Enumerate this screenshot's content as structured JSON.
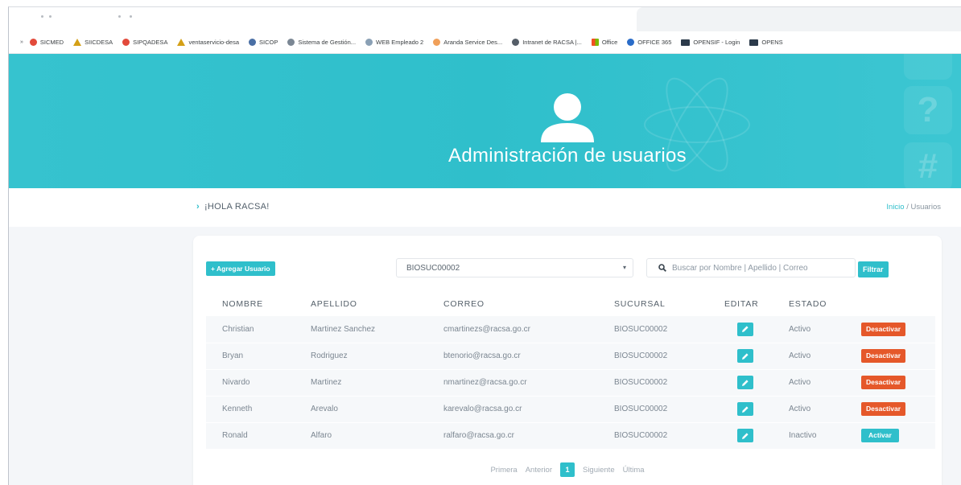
{
  "bookmarks": [
    "SICMED",
    "SIICDESA",
    "SIPQADESA",
    "ventaservicio-desa",
    "SICOP",
    "Sistema de Gestión...",
    "WEB Empleado 2",
    "Aranda Service Des...",
    "Intranet de RACSA |...",
    "Office",
    "OFFICE 365",
    "OPENSIF - Login",
    "OPENS"
  ],
  "hero": {
    "title": "Administración de usuarios",
    "side_icons": [
      "?",
      "#"
    ]
  },
  "greeting": "¡HOLA RACSA!",
  "breadcrumb": {
    "home": "Inicio",
    "separator": " / ",
    "current": "Usuarios"
  },
  "toolbar": {
    "add_label": "+ Agregar Usuario",
    "branch_value": "BIOSUC00002",
    "search_placeholder": "Buscar por Nombre | Apellido | Correo",
    "filter_label": "Filtrar"
  },
  "table": {
    "headers": {
      "name": "NOMBRE",
      "surname": "APELLIDO",
      "email": "CORREO",
      "branch": "SUCURSAL",
      "edit": "EDITAR",
      "status": "ESTADO"
    },
    "rows": [
      {
        "name": "Christian",
        "surname": "Martinez Sanchez",
        "email": "cmartinezs@racsa.go.cr",
        "branch": "BIOSUC00002",
        "status": "Activo",
        "action": "Desactivar"
      },
      {
        "name": "Bryan",
        "surname": "Rodriguez",
        "email": "btenorio@racsa.go.cr",
        "branch": "BIOSUC00002",
        "status": "Activo",
        "action": "Desactivar"
      },
      {
        "name": "Nivardo",
        "surname": "Martinez",
        "email": "nmartinez@racsa.go.cr",
        "branch": "BIOSUC00002",
        "status": "Activo",
        "action": "Desactivar"
      },
      {
        "name": "Kenneth",
        "surname": "Arevalo",
        "email": "karevalo@racsa.go.cr",
        "branch": "BIOSUC00002",
        "status": "Activo",
        "action": "Desactivar"
      },
      {
        "name": "Ronald",
        "surname": "Alfaro",
        "email": "ralfaro@racsa.go.cr",
        "branch": "BIOSUC00002",
        "status": "Inactivo",
        "action": "Activar"
      }
    ]
  },
  "pagination": {
    "first": "Primera",
    "prev": "Anterior",
    "current": "1",
    "next": "Siguiente",
    "last": "Última"
  },
  "colors": {
    "accent": "#2fbfcb",
    "danger": "#e5582a",
    "page_bg": "#f4f6f9"
  }
}
